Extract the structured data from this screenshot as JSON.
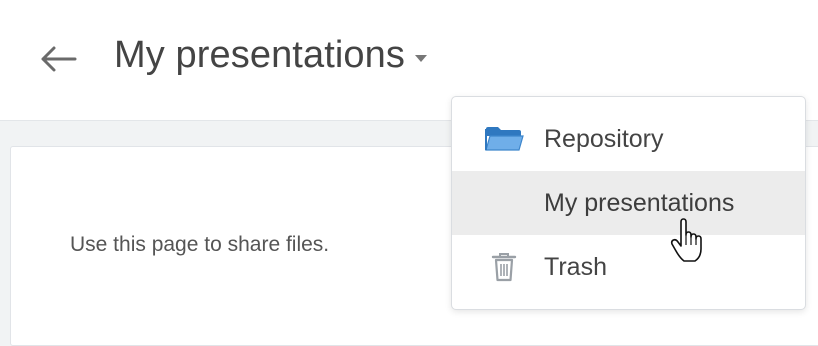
{
  "header": {
    "back_icon": "arrow-left-icon",
    "title": "My presentations",
    "title_caret_icon": "caret-down-icon"
  },
  "content": {
    "empty_message": "Use this page to share files."
  },
  "dropdown": {
    "items": [
      {
        "label": "Repository",
        "icon": "folder-icon",
        "selected": false
      },
      {
        "label": "My presentations",
        "icon": "",
        "selected": true
      },
      {
        "label": "Trash",
        "icon": "trash-icon",
        "selected": false
      }
    ]
  },
  "pointer": {
    "icon": "hand-pointer-icon"
  },
  "colors": {
    "folder": "#5b9bd5",
    "highlight": "#ececec",
    "text": "#444444",
    "muted_icon": "#9aa0a6"
  }
}
